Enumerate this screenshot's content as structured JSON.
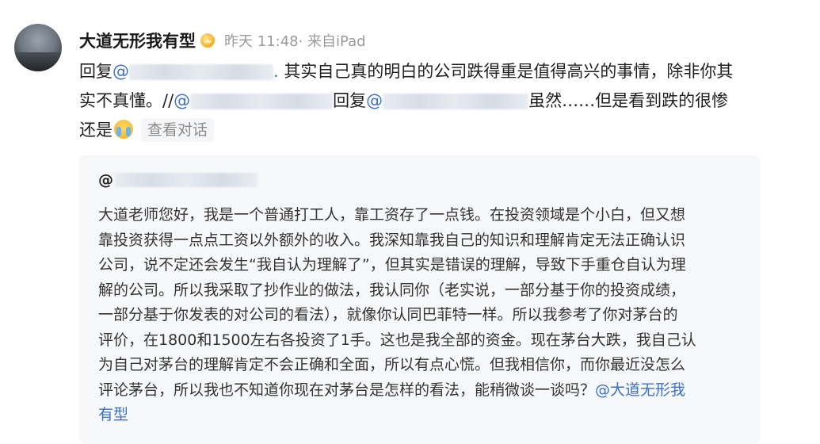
{
  "post": {
    "username": "大道无形我有型",
    "badge_icon": "vip-crown-badge-icon",
    "meta": "昨天 11:48· 来自iPad",
    "lines": [
      {
        "reply_prefix": "回复",
        "mention_at": "@",
        "mention_tail": ".",
        "text": " 其实自己真的明白的公司跌得重是值得高兴的事情，除非你其"
      },
      {
        "text_start": "实不真懂。//",
        "mention_at": "@",
        "reply_middle": "回复",
        "mention_at2": "@",
        "text_end": "虽然……但是看到跌的很惨"
      },
      {
        "text": "还是",
        "emoji_icon": "crying-face-emoji-icon",
        "view_conversation": "查看对话"
      }
    ]
  },
  "quoted": {
    "at": "@",
    "lines": [
      "大道老师您好，我是一个普通打工人，靠工资存了一点钱。在投资领域是个小白，但又想",
      "靠投资获得一点点工资以外额外的收入。我深知靠我自己的知识和理解肯定无法正确认识",
      "公司，说不定还会发生“我自认为理解了”，但其实是错误的理解，导致下手重仓自认为理",
      "解的公司。所以我采取了抄作业的做法，我认同你（老实说，一部分基于你的投资成绩，",
      "一部分基于你发表的对公司的看法），就像你认同巴菲特一样。所以我参考了你对茅台的",
      "评价，在1800和1500左右各投资了1手。这也是我全部的资金。现在茅台大跌，我自己认",
      "为自己对茅台的理解肯定不会正确和全面，所以有点心慌。但我相信你，而你最近没怎么"
    ],
    "line8_text": "评论茅台，所以我也不知道你现在对茅台是怎样的看法，能稍微谈一谈吗？",
    "line8_mention": "@大道无形我",
    "line9_mention": "有型"
  },
  "colors": {
    "mention": "#3b72c8",
    "meta": "#9a9a9a",
    "quote_bg": "#f7f8fa"
  }
}
